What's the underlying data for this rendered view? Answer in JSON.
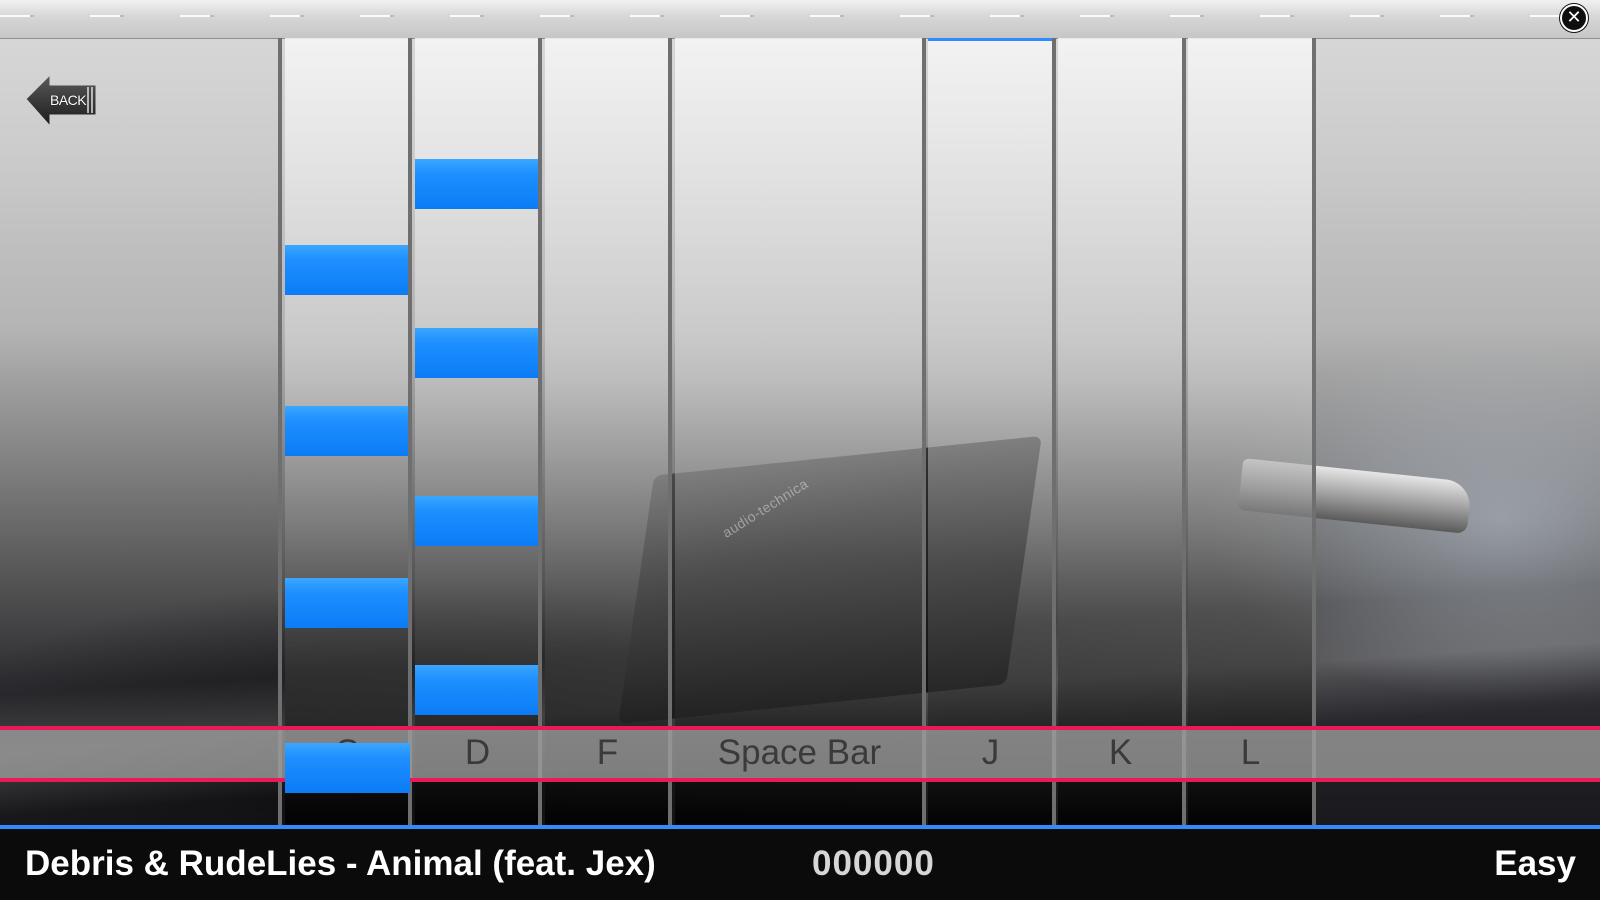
{
  "window": {
    "close_icon": "close-circle-icon",
    "close_glyph": "✕"
  },
  "nav": {
    "back_label": "BACK",
    "back_icon": "arrow-left-icon"
  },
  "playfield": {
    "lanes": [
      {
        "key": "S"
      },
      {
        "key": "D"
      },
      {
        "key": "F"
      },
      {
        "key": "Space Bar"
      },
      {
        "key": "J",
        "highlighted": true
      },
      {
        "key": "K"
      },
      {
        "key": "L"
      }
    ],
    "note_color": "#1e8fff",
    "hit_line_color": "#ea1a58",
    "accent_color": "#2f8cff"
  },
  "background": {
    "cartridge_brand": "audio-technica"
  },
  "status": {
    "song_title": "Debris & RudeLies - Animal (feat. Jex)",
    "score": "000000",
    "difficulty": "Easy"
  }
}
